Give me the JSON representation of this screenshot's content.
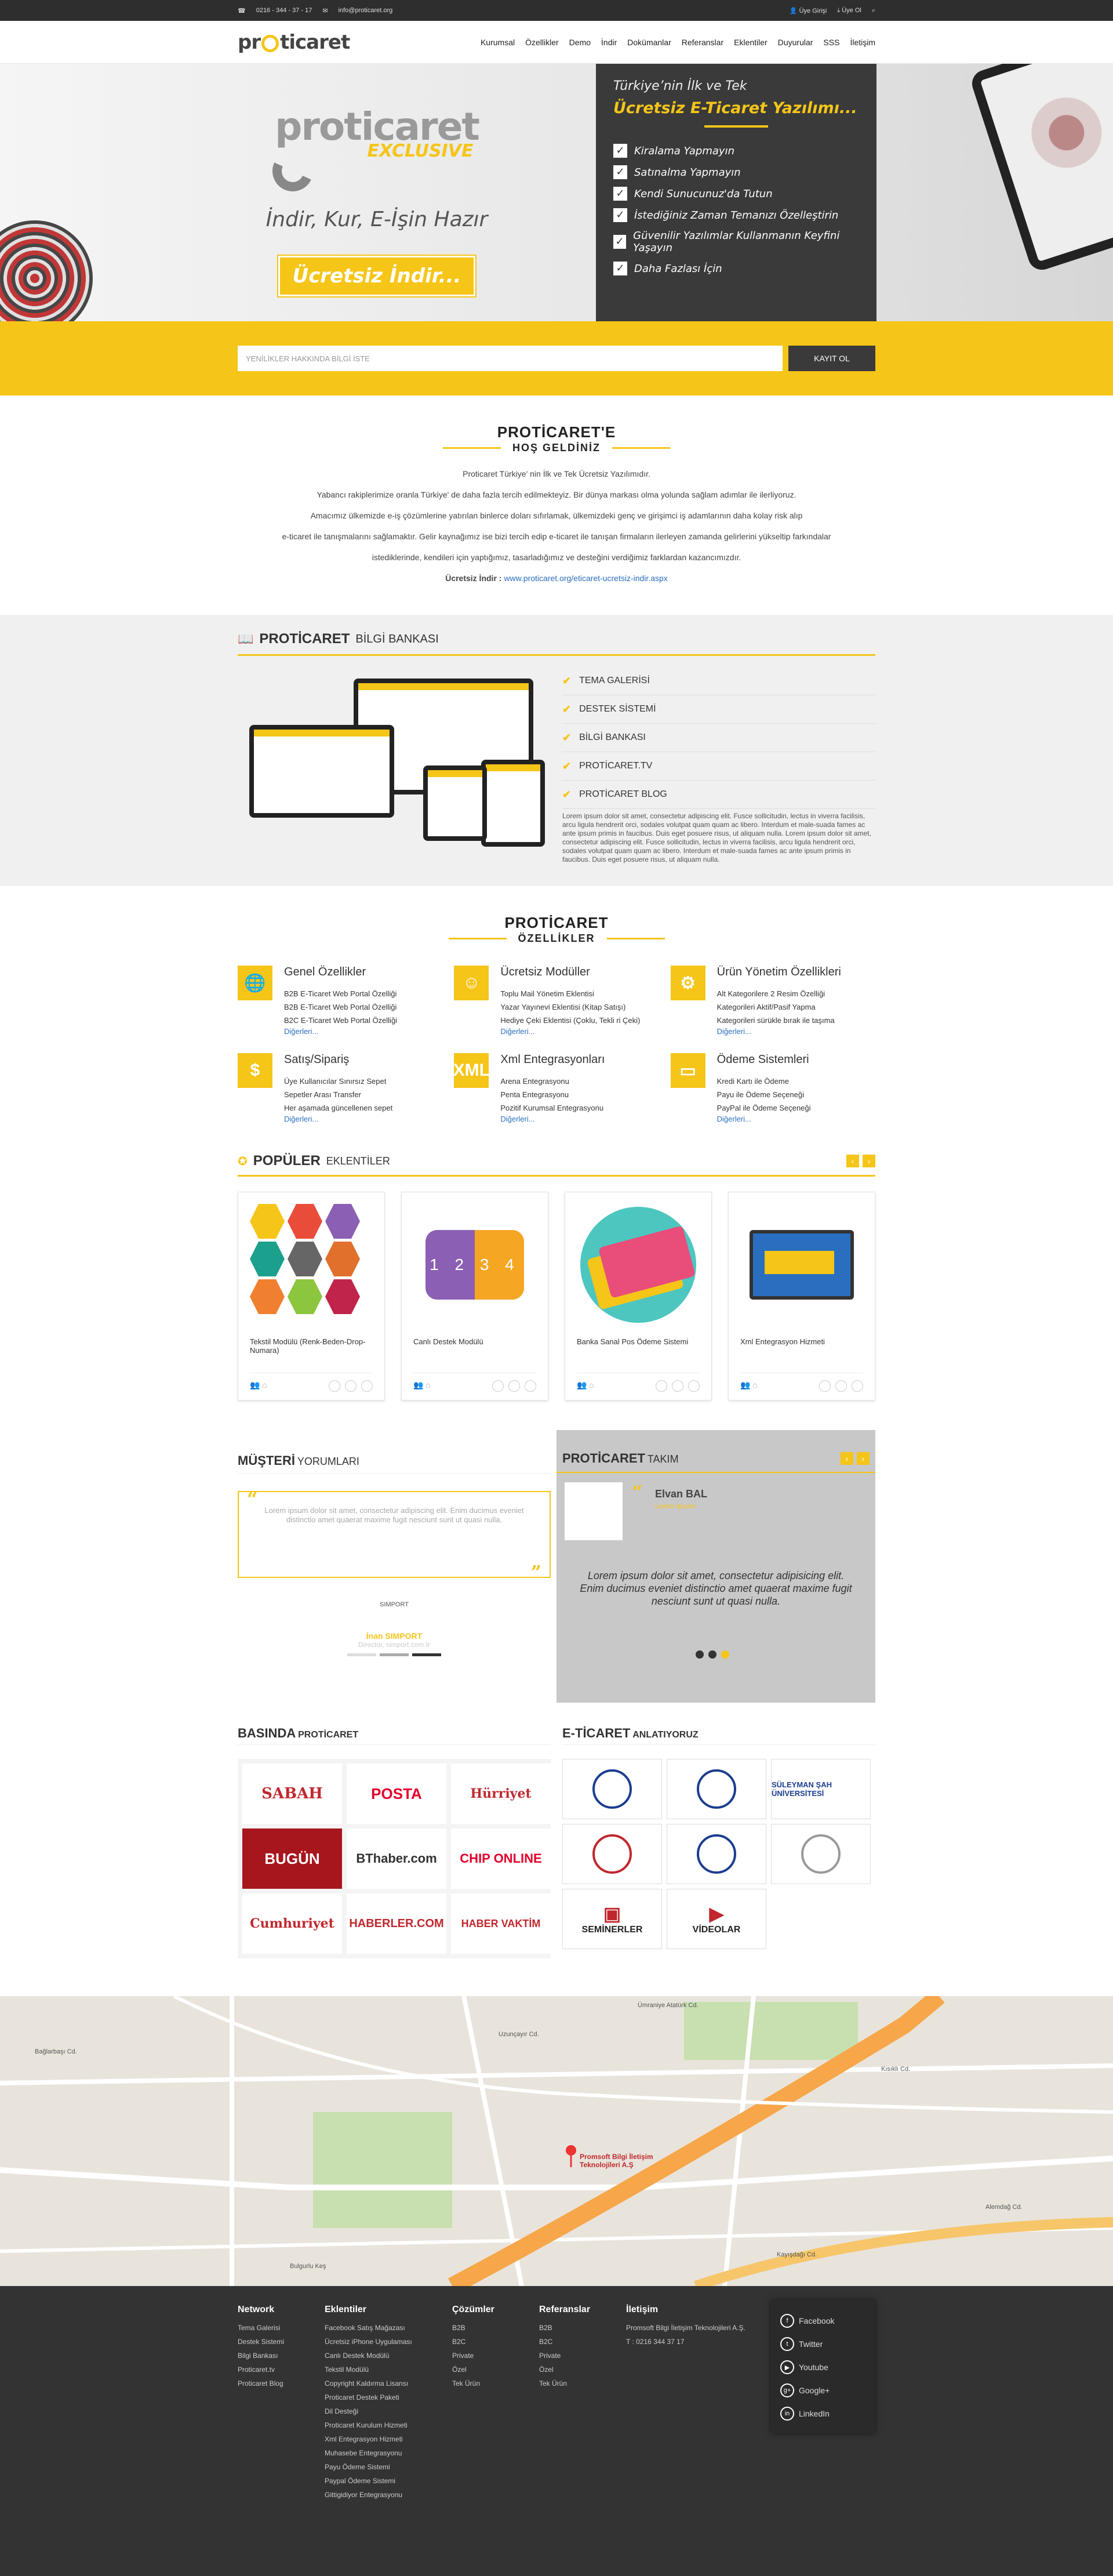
{
  "topbar": {
    "phone": "0216 - 344 - 37 - 17",
    "email": "info@proticaret.org",
    "login": "Üye Girişi",
    "register": "Üye Ol"
  },
  "header": {
    "logo": "proticaret",
    "nav": [
      "Kurumsal",
      "Özellikler",
      "Demo",
      "İndir",
      "Dokümanlar",
      "Referanslar",
      "Eklentiler",
      "Duyurular",
      "SSS",
      "İletişim"
    ]
  },
  "hero": {
    "logo": "proticaret",
    "exclusive": "EXCLUSIVE",
    "slogan": "İndir, Kur, E-İşin Hazır",
    "button": "Ücretsiz İndir...",
    "panel_sub": "Türkiye’nin İlk ve Tek",
    "panel_main": "Ücretsiz E-Ticaret Yazılımı...",
    "items": [
      "Kiralama Yapmayın",
      "Satınalma Yapmayın",
      "Kendi Sunucunuz'da Tutun",
      "İstediğiniz Zaman Temanızı Özelleştirin",
      "Güvenilir Yazılımlar Kullanmanın Keyfini Yaşayın",
      "Daha Fazlası İçin"
    ]
  },
  "newsletter": {
    "placeholder": "YENİLİKLER HAKKINDA BİLGİ İSTE",
    "button": "KAYIT OL"
  },
  "welcome": {
    "title": "PROTİCARET'E",
    "subtitle": "HOŞ GELDİNİZ",
    "p1": "Proticaret Türkiye' nin İlk ve Tek Ücretsiz Yazılımıdır.",
    "p2": "Yabancı rakiplerimize oranla Türkiye' de daha fazla tercih edilmekteyiz. Bir dünya markası olma yolunda sağlam adımlar ile ilerliyoruz.",
    "p3": "Amacımız ülkemizde e-iş çözümlerine yatırılan binlerce doları sıfırlamak, ülkemizdeki genç ve girişimci iş adamlarının daha kolay risk alıp",
    "p4": "e-ticaret ile tanışmalarını sağlamaktır. Gelir kaynağımız ise bizi tercih edip e-ticaret ile tanışan firmaların ilerleyen zamanda gelirlerini yükseltip farkındalar",
    "p5": "istediklerinde, kendileri için yaptığımız, tasarladığımız ve desteğini verdiğimiz farklardan kazancımızdır.",
    "dl_label": "Ücretsiz İndir :",
    "dl_link": "www.proticaret.org/eticaret-ucretsiz-indir.aspx"
  },
  "bilgi": {
    "t1": "PROTİCARET",
    "t2": "BİLGİ BANKASI",
    "items": [
      "TEMA GALERİSİ",
      "DESTEK SİSTEMİ",
      "BİLGİ BANKASI",
      "PROTİCARET.TV",
      "PROTİCARET BLOG"
    ],
    "lorem": "Lorem ipsum dolor sit amet, consectetur adipiscing elit. Fusce sollicitudin, lectus in viverra facilisis, arcu ligula hendrerit orci, sodales volutpat quam quam ac libero. Interdum et male-suada fames ac ante ipsum primis in faucibus. Duis eget posuere risus, ut aliquam nulla. Lorem ipsum dolor sit amet, consectetur adipiscing elit. Fusce sollicitudin, lectus in viverra facilisis, arcu ligula hendrerit orci, sodales volutpat quam quam ac libero. Interdum et male-suada fames ac ante ipsum primis in faucibus. Duis eget posuere risus, ut aliquam nulla."
  },
  "features": {
    "title": "PROTİCARET",
    "subtitle": "ÖZELLİKLER",
    "more": "Diğerleri...",
    "items": [
      {
        "icon": "🌐",
        "title": "Genel Özellikler",
        "lines": [
          "B2B E-Ticaret Web Portal Özelliği",
          "B2B E-Ticaret Web Portal Özelliği",
          "B2C E-Ticaret Web Portal Özelliği"
        ]
      },
      {
        "icon": "☺",
        "title": "Ücretsiz Modüller",
        "lines": [
          "Toplu Mail Yönetim Eklentisi",
          "Yazar Yayınevi Eklentisi (Kitap Satışı)",
          "Hediye Çeki Eklentisi (Çoklu, Tekli ri Çeki)"
        ]
      },
      {
        "icon": "⚙",
        "title": "Ürün Yönetim Özellikleri",
        "lines": [
          "Alt Kategorilere 2 Resim Özelliği",
          "Kategorileri Aktif/Pasif Yapma",
          "Kategorileri sürükle bırak ile taşıma"
        ]
      },
      {
        "icon": "$",
        "title": "Satış/Sipariş",
        "lines": [
          "Üye Kullanıcılar Sınırsız Sepet",
          "Sepetler Arası Transfer",
          "Her aşamada güncellenen sepet"
        ]
      },
      {
        "icon": "XML",
        "title": "Xml Entegrasyonları",
        "lines": [
          "Arena Entegrasyonu",
          "Penta Entegrasyonu",
          "Pozitif Kurumsal Entegrasyonu"
        ]
      },
      {
        "icon": "▭",
        "title": "Ödeme Sistemleri",
        "lines": [
          "Kredi Kartı ile Ödeme",
          "Payu ile Ödeme Seçeneği",
          "PayPal ile Ödeme Seçeneği"
        ]
      }
    ]
  },
  "popular": {
    "t1": "POPÜLER",
    "t2": "EKLENTİLER",
    "prev": "‹",
    "next": "›",
    "cards": [
      {
        "name": "Tekstil Modülü (Renk-Beden-Drop-Numara)"
      },
      {
        "name": "Canlı Destek Modülü",
        "chat": "1 2 3 4"
      },
      {
        "name": "Banka Sanal Pos Ödeme Sistemi"
      },
      {
        "name": "Xml Entegrasyon Hizmeti"
      }
    ]
  },
  "testimonials": {
    "t1": "MÜŞTERİ",
    "t2": "YORUMLARI",
    "quote": "Lorem ipsum dolor sit amet, consectetur adipiscing elit. Enim ducimus eveniet distinctio amet quaerat maxime fugit nesciunt sunt ut quasi nulla.",
    "logo": "SIMPORT",
    "name": "İnan SIMPORT",
    "role": "Director, simport.com.tr"
  },
  "team": {
    "t1": "PROTİCARET",
    "t2": "TAKIM",
    "name": "Elvan BAL",
    "role": "Lorem ipsum",
    "quote": "Lorem ipsum dolor sit amet, consectetur adipisicing elit. Enim ducimus eveniet distinctio amet quaerat maxime fugit nesciunt sunt ut quasi nulla."
  },
  "press": {
    "t1": "BASINDA",
    "t2": "PROTİCARET",
    "logos": [
      "SABAH",
      "POSTA",
      "Hürriyet",
      "BUGÜN",
      "BThaber.com",
      "CHIP ONLINE",
      "Cumhuriyet",
      "HABERLER.COM",
      "HABER VAKTİM"
    ]
  },
  "edu": {
    "t1": "E-TİCARET",
    "t2": "ANLATIYORUZ",
    "uni": "SÜLEYMAN ŞAH ÜNİVERSİTESİ",
    "seminars": "SEMİNERLER",
    "videos": "VİDEOLAR"
  },
  "map": {
    "pin": "Promsoft Bilgi İletişim Teknolojileri A.Ş",
    "streets": [
      "Alemdağ Cd.",
      "Bağlarbaşı Cd.",
      "Uzunçayır Cd.",
      "Kısıklı Cd.",
      "Kayışdağı Cd.",
      "Ümraniye Atatürk Cd.",
      "Bulgurlu Keş"
    ]
  },
  "footer": {
    "cols": [
      {
        "title": "Network",
        "links": [
          "Tema Galerisi",
          "Destek Sistemi",
          "Bilgi Bankası",
          "Proticaret.tv",
          "Proticaret Blog"
        ]
      },
      {
        "title": "Eklentiler",
        "links": [
          "Facebook Satış Mağazası",
          "Ücretsiz iPhone Uygulaması",
          "Canlı Destek Modülü",
          "Tekstil Modülü",
          "Copyright Kaldırma Lisansı",
          "Proticaret Destek Paketi",
          "Dil Desteği",
          "Proticaret Kurulum Hizmeti",
          "Xml Entegrasyon Hizmeti",
          "Muhasebe Entegrasyonu",
          "Payu Ödeme Sistemi",
          "Paypal Ödeme Sistemi",
          "Gittigidiyor Entegrasyonu"
        ]
      },
      {
        "title": "Çözümler",
        "links": [
          "B2B",
          "B2C",
          "Private",
          "Özel",
          "Tek Ürün"
        ]
      },
      {
        "title": "Referanslar",
        "links": [
          "B2B",
          "B2C",
          "Private",
          "Özel",
          "Tek Ürün"
        ]
      },
      {
        "title": "İletişim",
        "links": [
          "Promsoft Bilgi İletişim Teknolojileri A.Ş.",
          "T : 0216 344 37 17"
        ]
      }
    ],
    "social": [
      "Facebook",
      "Twitter",
      "Youtube",
      "Google+",
      "LinkedIn"
    ]
  }
}
